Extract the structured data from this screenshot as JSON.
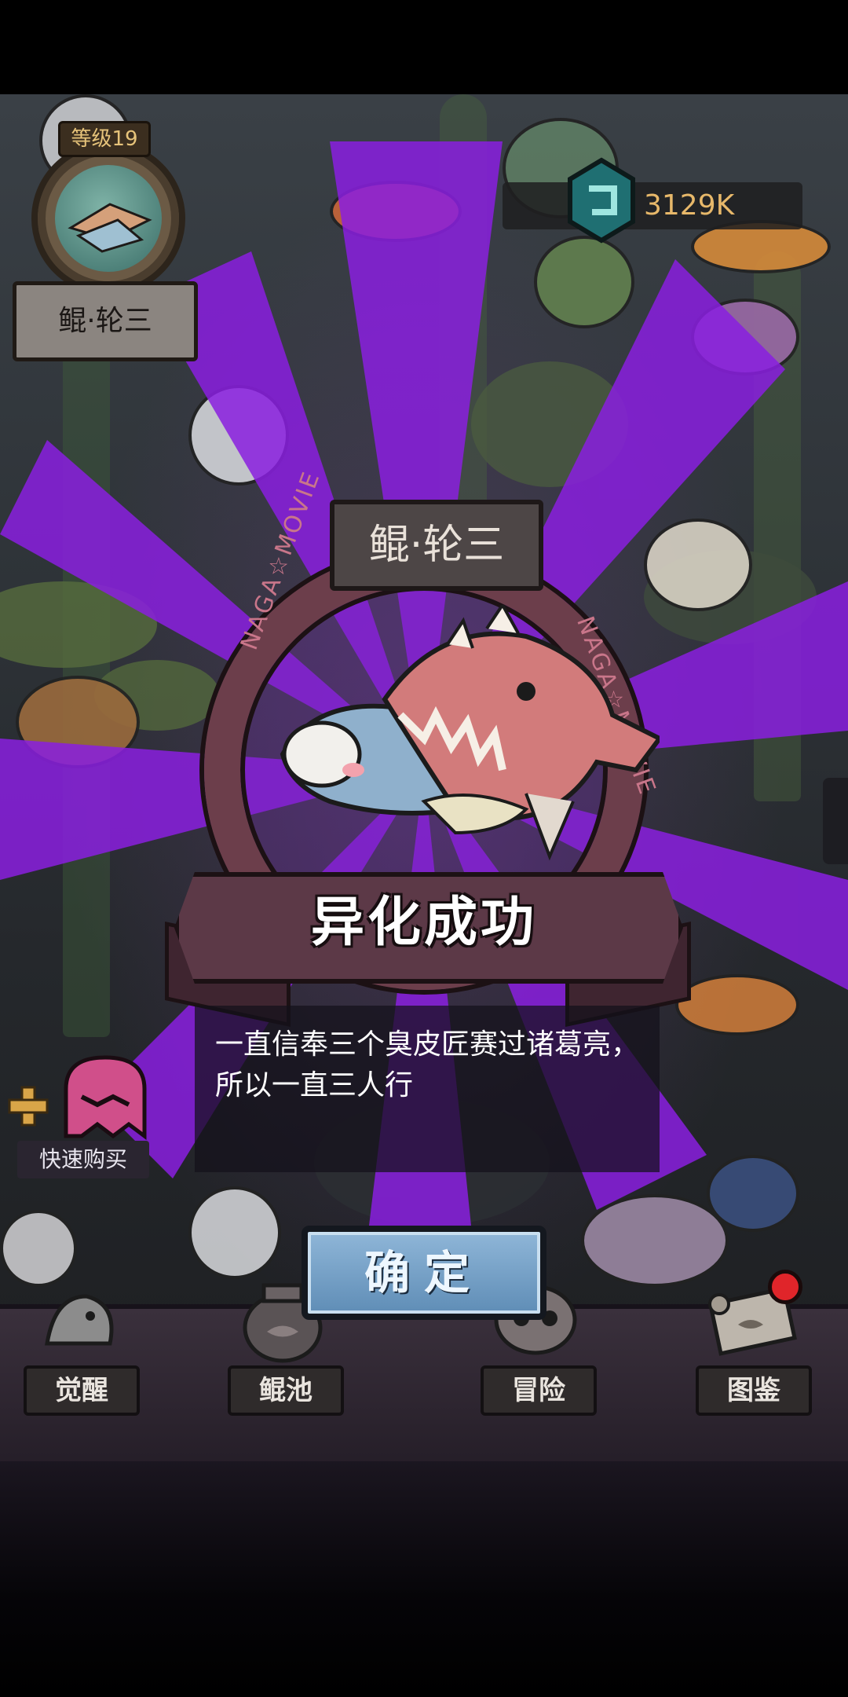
{
  "hud": {
    "level": "等级19",
    "player_name": "鲲·轮三",
    "currency": "3129K",
    "quick_buy": "快速购买"
  },
  "popup": {
    "fish_name": "鲲·轮三",
    "ring_text_left": "NAGA☆MOVIE",
    "ring_text_right": "NAGA☆MOVIE",
    "banner": "异化成功",
    "description": "一直信奉三个臭皮匠赛过诸葛亮，所以一直三人行",
    "confirm": "确定"
  },
  "nav": {
    "items": [
      {
        "label": "觉醒",
        "icon": "awaken-fish-icon"
      },
      {
        "label": "鲲池",
        "icon": "fish-pond-jar-icon"
      },
      {
        "label": "冒险",
        "icon": "adventure-skull-icon"
      },
      {
        "label": "图鉴",
        "icon": "scroll-catalog-icon"
      }
    ]
  },
  "colors": {
    "ray_purple": "#8a2be2",
    "banner_bg": "#5c3947",
    "button_blue": "#7fa7cc",
    "currency_gold": "#e7b86a"
  }
}
